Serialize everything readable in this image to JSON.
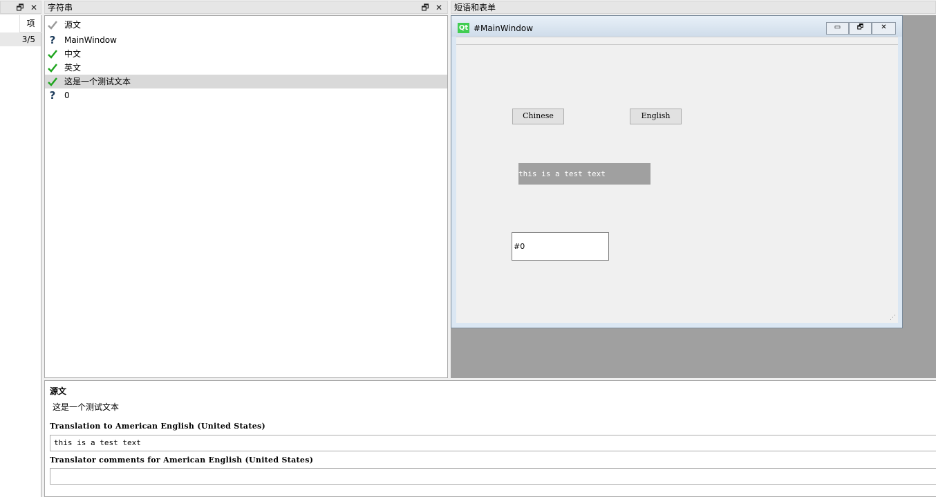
{
  "left_panel": {
    "header": "项",
    "value": "3/5"
  },
  "strings_panel": {
    "title": "字符串",
    "items": [
      {
        "status": "checked-gray",
        "label": "源文"
      },
      {
        "status": "question",
        "label": "MainWindow"
      },
      {
        "status": "checked-green",
        "label": "中文"
      },
      {
        "status": "checked-green",
        "label": "英文"
      },
      {
        "status": "checked-green",
        "label": "这是一个测试文本",
        "selected": true
      },
      {
        "status": "question",
        "label": "0"
      }
    ]
  },
  "phrases_panel": {
    "title": "短语和表单"
  },
  "form_preview": {
    "window_title": "#MainWindow",
    "app_badge": "Qt",
    "chinese_button": "Chinese",
    "english_button": "English",
    "label_text": "this is a test text",
    "line_edit_text": "#0"
  },
  "editor": {
    "source_label": "源文",
    "source_text": "这是一个测试文本",
    "translation_label": "Translation to American English (United States)",
    "translation_value": "this is a test text",
    "comments_label": "Translator comments for American English (United States)",
    "comments_value": ""
  },
  "icons": {
    "float": "float-icon",
    "close": "close-icon",
    "check_green": "#1fa51f",
    "check_gray": "#9a9a9a",
    "question": "#1b3a5a"
  }
}
